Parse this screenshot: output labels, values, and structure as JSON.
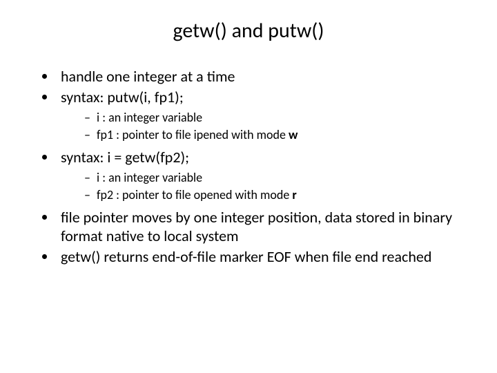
{
  "title": "getw() and putw()",
  "bullets": {
    "b1": "handle one integer at a time",
    "b2": "syntax:  putw(i, fp1);",
    "b2_sub1": "i : an integer variable",
    "b2_sub2_pre": "fp1 : pointer to file ipened with mode ",
    "b2_sub2_bold": "w",
    "b3": "syntax: i = getw(fp2);",
    "b3_sub1": "i : an integer variable",
    "b3_sub2_pre": "fp2 : pointer to file opened with mode ",
    "b3_sub2_bold": "r",
    "b4": "file pointer moves by one integer position, data stored in binary format native to local system",
    "b5": "getw() returns end-of-file marker EOF when file end reached"
  }
}
